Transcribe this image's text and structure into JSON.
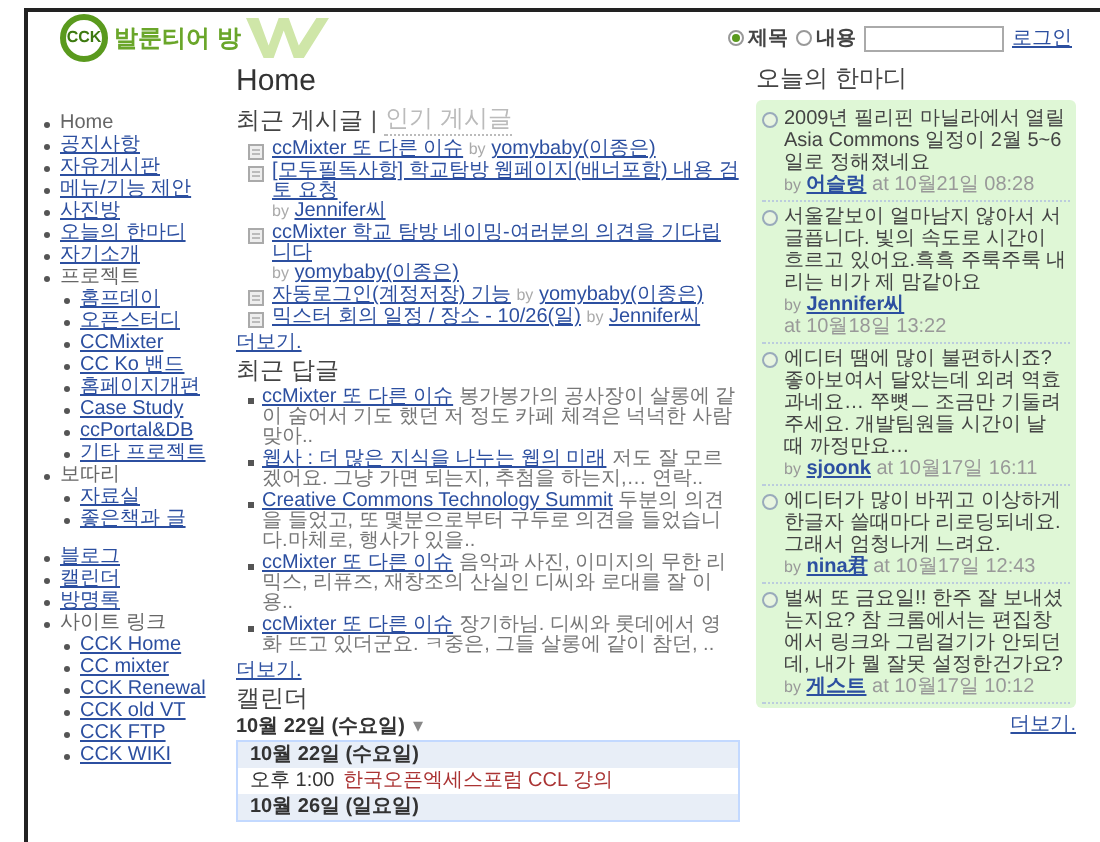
{
  "header": {
    "logo_mark": "CCK",
    "site_name": "발룬티어 방"
  },
  "search": {
    "options": [
      {
        "label": "제목",
        "selected": true
      },
      {
        "label": "내용",
        "selected": false
      }
    ],
    "login": "로그인"
  },
  "sidebar": {
    "groups": [
      [
        {
          "label": "Home",
          "link": false
        },
        {
          "label": "공지사항",
          "link": true
        },
        {
          "label": "자유게시판",
          "link": true
        },
        {
          "label": "메뉴/기능 제안",
          "link": true
        },
        {
          "label": "사진방",
          "link": true
        },
        {
          "label": "오늘의 한마디",
          "link": true
        },
        {
          "label": "자기소개",
          "link": true
        },
        {
          "label": "프로젝트",
          "link": false,
          "children": [
            {
              "label": "홈프데이",
              "link": true
            },
            {
              "label": "오픈스터디",
              "link": true
            },
            {
              "label": "CCMixter",
              "link": true
            },
            {
              "label": "CC Ko 밴드",
              "link": true
            },
            {
              "label": "홈페이지개편",
              "link": true
            },
            {
              "label": "Case Study",
              "link": true
            },
            {
              "label": "ccPortal&DB",
              "link": true
            },
            {
              "label": "기타 프로젝트",
              "link": true
            }
          ]
        },
        {
          "label": "보따리",
          "link": false,
          "children": [
            {
              "label": "자료실",
              "link": true
            },
            {
              "label": "좋은책과 글",
              "link": true
            }
          ]
        }
      ],
      [
        {
          "label": "블로그",
          "link": true
        },
        {
          "label": "캘린더",
          "link": true
        },
        {
          "label": "방명록",
          "link": true
        },
        {
          "label": "사이트 링크",
          "link": false,
          "children": [
            {
              "label": "CCK Home",
              "link": true
            },
            {
              "label": "CC mixter",
              "link": true
            },
            {
              "label": "CCK Renewal",
              "link": true
            },
            {
              "label": "CCK old VT",
              "link": true
            },
            {
              "label": "CCK FTP",
              "link": true
            },
            {
              "label": "CCK WIKI",
              "link": true
            }
          ]
        }
      ]
    ]
  },
  "page_title": "Home",
  "recent_posts": {
    "tabs": [
      {
        "label": "최근 게시글",
        "selected": true
      },
      {
        "label": "인기 게시글",
        "selected": false
      }
    ],
    "separator": "|",
    "items": [
      {
        "title": "ccMixter 또 다른 이슈",
        "by": "by",
        "author": "yomybaby(이종은)"
      },
      {
        "title": "[모두필독사항] 학교탐방 웹페이지(배너포함) 내용 검토 요청",
        "by": "by",
        "author": "Jennifer씨"
      },
      {
        "title": "ccMixter 학교 탐방 네이밍-여러분의 의견을 기다립니다",
        "by": "by",
        "author": "yomybaby(이종은)"
      },
      {
        "title": "자동로그인(계정저장) 기능",
        "by": "by",
        "author": "yomybaby(이종은)"
      },
      {
        "title": "믹스터 회의 일정 / 장소 - 10/26(일)",
        "by": "by",
        "author": "Jennifer씨"
      }
    ],
    "more": "더보기."
  },
  "recent_replies": {
    "title": "최근 답글",
    "items": [
      {
        "title": "ccMixter 또 다른 이슈",
        "excerpt": "봉가봉가의 공사장이 살롱에 같이 숨어서 기도 했던 저 정도 카페 체격은 넉넉한 사람 맞아.."
      },
      {
        "title": "웹사 : 더 많은 지식을 나누는 웹의 미래",
        "excerpt": "저도 잘 모르겠어요. 그냥 가면 되는지, 추첨을 하는지,… 연락.."
      },
      {
        "title": "Creative Commons Technology Summit",
        "excerpt": "두분의 의견을 들었고, 또 몇분으로부터 구두로 의견을 들었습니다.마체로, 행사가 있을.."
      },
      {
        "title": "ccMixter 또 다른 이슈",
        "excerpt": "음악과 사진, 이미지의 무한 리믹스, 리퓨즈, 재창조의 산실인 디씨와 로대를 잘 이용.."
      },
      {
        "title": "ccMixter 또 다른 이슈",
        "excerpt": "장기하님. 디씨와 롯데에서 영화 뜨고 있더군요. ㅋ중은, 그들 살롱에 같이 참던, .."
      }
    ],
    "more": "더보기."
  },
  "calendar": {
    "title": "캘린더",
    "current_date": "10월 22일 (수요일)",
    "dropdown": "▾",
    "rows": [
      {
        "kind": "date",
        "text": "10월 22일 (수요일)"
      },
      {
        "kind": "event",
        "time": "오후 1:00",
        "text": "한국오픈엑세스포럼 CCL 강의"
      },
      {
        "kind": "date",
        "text": "10월 26일 (일요일)"
      }
    ]
  },
  "today_words": {
    "title": "오늘의 한마디",
    "items": [
      {
        "text": "2009년 필리핀 마닐라에서 열릴 Asia Commons 일정이 2월 5~6일로 정해졌네요",
        "by": "by",
        "author": "어슬렁",
        "time": "at 10월21일 08:28"
      },
      {
        "text": "서울같보이 얼마남지 않아서 서글픕니다. 빛의 속도로 시간이 흐르고 있어요.흑흑 주룩주룩 내리는 비가 제 맘같아요",
        "by": "by",
        "author": "Jennifer씨",
        "time": "at 10월18일 13:22"
      },
      {
        "text": "에디터 땜에 많이 불편하시죠? 좋아보여서 달았는데 외려 역효과네요… 쭈뼛ㅡ 조금만 기둘려 주세요. 개발팀원들 시간이 날 때 까정만요…",
        "by": "by",
        "author": "sjoonk",
        "time": "at 10월17일 16:11"
      },
      {
        "text": "에디터가 많이 바뀌고 이상하게 한글자 쓸때마다 리로딩되네요. 그래서 엄청나게 느려요.",
        "by": "by",
        "author": "nina君",
        "time": "at 10월17일 12:43"
      },
      {
        "text": "벌써 또 금요일!! 한주 잘 보내셨는지요? 참 크롬에서는 편집창에서 링크와 그림걸기가 안되던데, 내가 뭘 잘못 설정한건가요?",
        "by": "by",
        "author": "게스트",
        "time": "at 10월17일 10:12"
      }
    ],
    "more": "더보기."
  }
}
